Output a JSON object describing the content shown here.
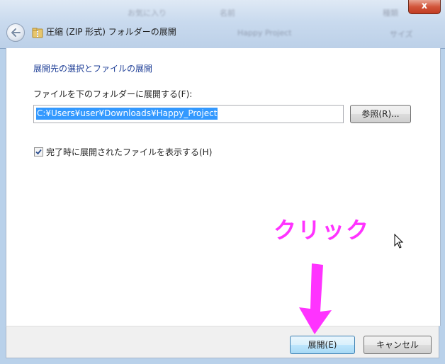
{
  "window": {
    "title": "圧縮 (ZIP 形式) フォルダーの展開",
    "close_label": "x"
  },
  "background": {
    "items": [
      "お気に入り",
      "名前",
      "Happy Project",
      "種類",
      "サイズ"
    ]
  },
  "wizard": {
    "heading": "展開先の選択とファイルの展開",
    "path_label": "ファイルを下のフォルダーに展開する(F):",
    "path_value": "C:¥Users¥user¥Downloads¥Happy_Project",
    "browse_label": "参照(R)...",
    "show_files_checked": true,
    "show_files_label": "完了時に展開されたファイルを表示する(H)"
  },
  "footer": {
    "extract_label": "展開(E)",
    "cancel_label": "キャンセル"
  },
  "annotation": {
    "text": "クリック"
  },
  "colors": {
    "heading": "#1f3f97",
    "selection": "#3399ff",
    "annotation": "#ff33ff"
  }
}
